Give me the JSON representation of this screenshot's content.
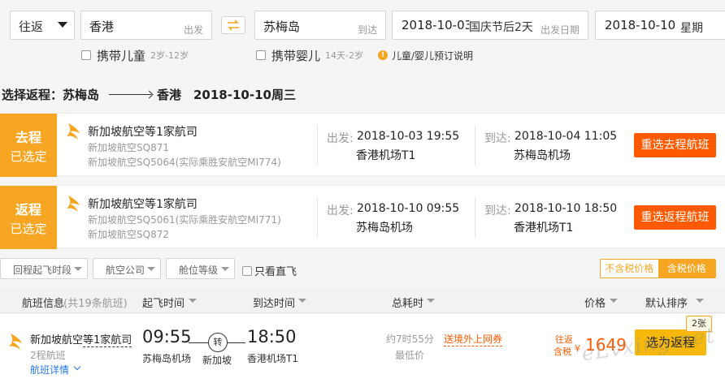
{
  "search": {
    "trip_type": "往返",
    "from_city": "香港",
    "from_tag": "出发",
    "to_city": "苏梅岛",
    "to_tag": "到达",
    "depart_date": "2018-10-03",
    "depart_note": "国庆节后2天",
    "depart_tag": "出发日期",
    "return_date": "2018-10-10",
    "return_tag": "星期"
  },
  "options": {
    "child_label": "携带儿童",
    "child_hint": "2岁-12岁",
    "infant_label": "携带婴儿",
    "infant_hint": "14天-2岁",
    "info_label": "儿童/婴儿预订说明",
    "info_icon": "!"
  },
  "heading": {
    "title": "选择返程：苏梅岛",
    "dest": "香港",
    "date": "2018-10-10周三"
  },
  "legs": {
    "outbound": {
      "badge_top": "去程",
      "badge_bottom": "已选定",
      "airline": "新加坡航空等1家航司",
      "flight1": "新加坡航空SQ871",
      "flight2": "新加坡航空SQ5064(实际乘胜安航空MI774)",
      "dep_label": "出发:",
      "dep_time": "2018-10-03 19:55",
      "dep_airport": "香港机场T1",
      "arr_label": "到达:",
      "arr_time": "2018-10-04 11:05",
      "arr_airport": "苏梅岛机场",
      "button": "重选去程航班"
    },
    "return": {
      "badge_top": "返程",
      "badge_bottom": "已选定",
      "airline": "新加坡航空等1家航司",
      "flight1": "新加坡航空SQ5061(实际乘胜安航空MI771)",
      "flight2": "新加坡航空SQ872",
      "dep_label": "出发:",
      "dep_time": "2018-10-10 09:55",
      "dep_airport": "苏梅岛机场",
      "arr_label": "到达:",
      "arr_time": "2018-10-10 18:50",
      "arr_airport": "香港机场T1",
      "button": "重选返程航班"
    }
  },
  "filters": {
    "return_time": "回程起飞时段",
    "airline": "航空公司",
    "cabin": "舱位等级",
    "direct_only": "只看直飞",
    "price_excl_tax": "不含税价格",
    "price_incl_tax": "含税价格"
  },
  "list_header": {
    "info": "航班信息",
    "count": "(共19条航班)",
    "dep": "起飞时间",
    "arr": "到达时间",
    "duration": "总耗时",
    "price": "价格",
    "sort": "默认排序"
  },
  "flight": {
    "airline": "新加坡航空",
    "airline_more": "等1家航司",
    "stops": "2程航班",
    "detail": "航班详情",
    "dep_time": "09:55",
    "dep_airport": "苏梅岛机场",
    "transfer_icon": "转",
    "transfer_city": "新加坡",
    "arr_time": "18:50",
    "arr_airport": "香港机场T1",
    "duration": "约7时55分",
    "lowest": "最低价",
    "promo": "送境外上网券",
    "roundtrip": "往返",
    "tax_incl": "含税",
    "currency": "¥",
    "price": "1649",
    "book": "选为返程",
    "seats": "2张"
  },
  "watermark": "eLvxing.net",
  "colors": {
    "accent_orange": "#f6a623",
    "cta_red": "#ff5a00",
    "book_yellow": "#f6b80a",
    "link_blue": "#2577e3"
  }
}
